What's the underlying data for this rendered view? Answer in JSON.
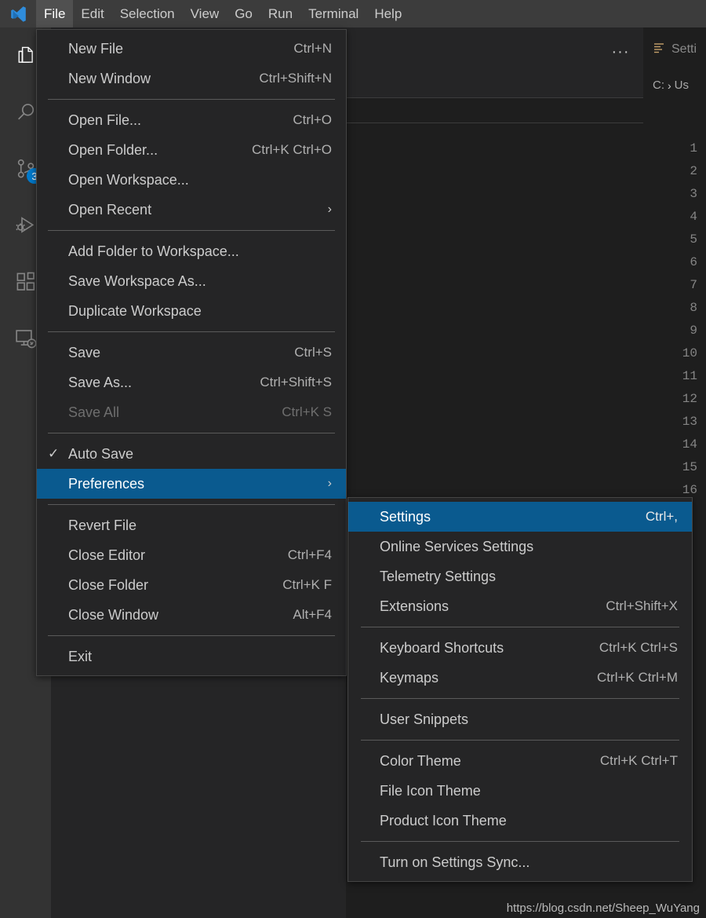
{
  "app": {
    "logo_icon": "vscode-logo-icon"
  },
  "menubar": {
    "items": [
      {
        "label": "File",
        "active": true
      },
      {
        "label": "Edit",
        "active": false
      },
      {
        "label": "Selection",
        "active": false
      },
      {
        "label": "View",
        "active": false
      },
      {
        "label": "Go",
        "active": false
      },
      {
        "label": "Run",
        "active": false
      },
      {
        "label": "Terminal",
        "active": false
      },
      {
        "label": "Help",
        "active": false
      }
    ]
  },
  "activity_bar": {
    "items": [
      {
        "name": "explorer",
        "icon": "files-icon",
        "badge": null
      },
      {
        "name": "search",
        "icon": "search-icon",
        "badge": null
      },
      {
        "name": "source-control",
        "icon": "source-control-icon",
        "badge": "3"
      },
      {
        "name": "run-and-debug",
        "icon": "run-debug-icon",
        "badge": null
      },
      {
        "name": "extensions",
        "icon": "extensions-icon",
        "badge": null
      },
      {
        "name": "remote-explorer",
        "icon": "remote-explorer-icon",
        "badge": null
      }
    ],
    "badge_color": "#007acc"
  },
  "editor": {
    "more_actions_label": "···",
    "tab_label": "Setti",
    "tab_icon": "settings-tab-icon",
    "breadcrumb": [
      "C:",
      "Us"
    ],
    "breadcrumb_separator": "›",
    "line_numbers": [
      "1",
      "2",
      "3",
      "4",
      "5",
      "6",
      "7",
      "8",
      "9",
      "10",
      "11",
      "12",
      "13",
      "14",
      "15",
      "16"
    ]
  },
  "file_menu": {
    "groups": [
      [
        {
          "label": "New File",
          "key": "Ctrl+N"
        },
        {
          "label": "New Window",
          "key": "Ctrl+Shift+N"
        }
      ],
      [
        {
          "label": "Open File...",
          "key": "Ctrl+O"
        },
        {
          "label": "Open Folder...",
          "key": "Ctrl+K Ctrl+O"
        },
        {
          "label": "Open Workspace...",
          "key": ""
        },
        {
          "label": "Open Recent",
          "key": "",
          "submenu": true
        }
      ],
      [
        {
          "label": "Add Folder to Workspace...",
          "key": ""
        },
        {
          "label": "Save Workspace As...",
          "key": ""
        },
        {
          "label": "Duplicate Workspace",
          "key": ""
        }
      ],
      [
        {
          "label": "Save",
          "key": "Ctrl+S"
        },
        {
          "label": "Save As...",
          "key": "Ctrl+Shift+S"
        },
        {
          "label": "Save All",
          "key": "Ctrl+K S",
          "disabled": true
        }
      ],
      [
        {
          "label": "Auto Save",
          "key": "",
          "checked": true
        },
        {
          "label": "Preferences",
          "key": "",
          "submenu": true,
          "highlight": true
        }
      ],
      [
        {
          "label": "Revert File",
          "key": ""
        },
        {
          "label": "Close Editor",
          "key": "Ctrl+F4"
        },
        {
          "label": "Close Folder",
          "key": "Ctrl+K F"
        },
        {
          "label": "Close Window",
          "key": "Alt+F4"
        }
      ],
      [
        {
          "label": "Exit",
          "key": ""
        }
      ]
    ],
    "check_glyph": "✓",
    "submenu_glyph": "›"
  },
  "preferences_menu": {
    "groups": [
      [
        {
          "label": "Settings",
          "key": "Ctrl+,",
          "highlight": true
        },
        {
          "label": "Online Services Settings",
          "key": ""
        },
        {
          "label": "Telemetry Settings",
          "key": ""
        },
        {
          "label": "Extensions",
          "key": "Ctrl+Shift+X"
        }
      ],
      [
        {
          "label": "Keyboard Shortcuts",
          "key": "Ctrl+K Ctrl+S"
        },
        {
          "label": "Keymaps",
          "key": "Ctrl+K Ctrl+M"
        }
      ],
      [
        {
          "label": "User Snippets",
          "key": ""
        }
      ],
      [
        {
          "label": "Color Theme",
          "key": "Ctrl+K Ctrl+T"
        },
        {
          "label": "File Icon Theme",
          "key": ""
        },
        {
          "label": "Product Icon Theme",
          "key": ""
        }
      ],
      [
        {
          "label": "Turn on Settings Sync...",
          "key": ""
        }
      ]
    ]
  },
  "watermark": {
    "text": "https://blog.csdn.net/Sheep_WuYang"
  }
}
